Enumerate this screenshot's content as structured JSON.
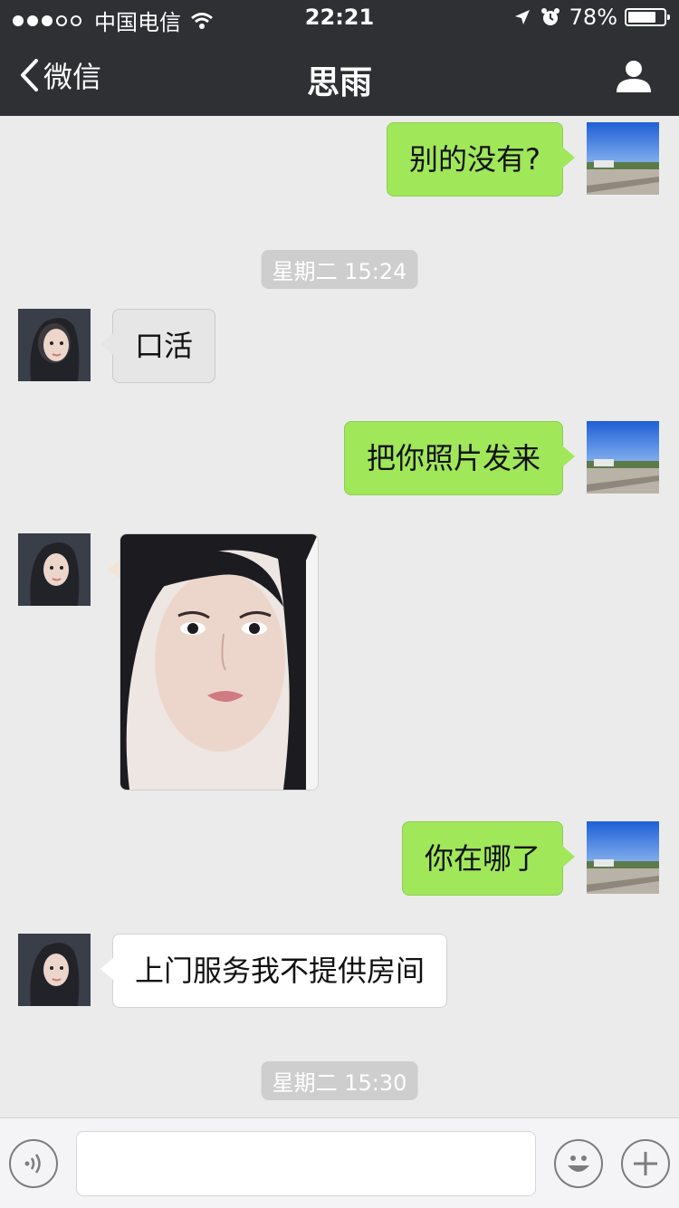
{
  "status_bar": {
    "carrier": "中国电信",
    "time": "22:21",
    "battery": "78%",
    "battery_level": 0.78,
    "signal_strength": 3,
    "signal_total": 5
  },
  "nav": {
    "back_label": "微信",
    "title": "思雨"
  },
  "messages": [
    {
      "side": "out",
      "text": "别的没有?"
    },
    {
      "type": "timestamp",
      "text": "星期二 15:24"
    },
    {
      "side": "in",
      "text": "口活"
    },
    {
      "side": "out",
      "text": "把你照片发来"
    },
    {
      "side": "in",
      "type": "photo"
    },
    {
      "side": "out",
      "text": "你在哪了"
    },
    {
      "side": "in",
      "text": "上门服务我不提供房间"
    },
    {
      "type": "timestamp",
      "text": "星期二 15:30"
    }
  ],
  "input": {
    "value": "",
    "placeholder": ""
  },
  "colors": {
    "header_bg": "#2f3033",
    "chat_bg": "#ebebeb",
    "outgoing_bubble": "#a0e75a",
    "incoming_bubble_gray": "#e6e6e6",
    "incoming_bubble_white": "#ffffff",
    "timestamp_bg": "#cecece"
  },
  "icons": [
    "signal-dots-icon",
    "wifi-icon",
    "location-arrow-icon",
    "alarm-icon",
    "battery-icon",
    "chevron-left-icon",
    "person-icon",
    "voice-icon",
    "emoji-icon",
    "plus-icon"
  ]
}
